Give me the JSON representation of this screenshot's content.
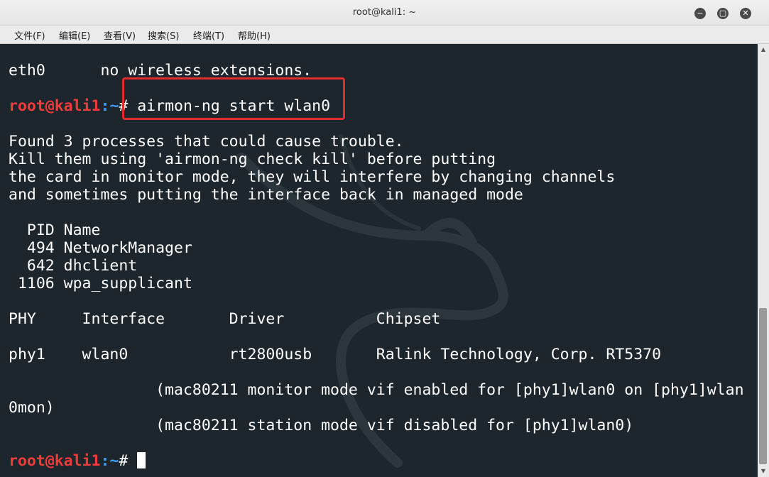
{
  "window": {
    "title": "root@kali1: ~",
    "controls": {
      "minimize": "−",
      "maximize": "▢",
      "close": "✕"
    }
  },
  "menu": [
    "文件(F)",
    "编辑(E)",
    "查看(V)",
    "搜索(S)",
    "终端(T)",
    "帮助(H)"
  ],
  "terminal": {
    "line_eth0": "eth0      no wireless extensions.",
    "prompt1": {
      "user": "root@kali1",
      "path": ":~",
      "command": "# airmon-ng start wlan0"
    },
    "warn1": "Found 3 processes that could cause trouble.",
    "warn2": "Kill them using 'airmon-ng check kill' before putting",
    "warn3": "the card in monitor mode, they will interfere by changing channels",
    "warn4": "and sometimes putting the interface back in managed mode",
    "proc_header": "  PID Name",
    "proc1": "  494 NetworkManager",
    "proc2": "  642 dhclient",
    "proc3": " 1106 wpa_supplicant",
    "iface_header": "PHY     Interface       Driver          Chipset",
    "iface_row": "phy1    wlan0           rt2800usb       Ralink Technology, Corp. RT5370",
    "mon1a": "                (mac80211 monitor mode vif enabled for [phy1]wlan0 on [phy1]wlan",
    "mon1b": "0mon)",
    "mon2": "                (mac80211 station mode vif disabled for [phy1]wlan0)",
    "prompt2": {
      "user": "root@kali1",
      "path": ":~",
      "command": "# "
    }
  },
  "colors": {
    "background": "#1c262c",
    "text": "#ffffff",
    "prompt_user": "#ef3b3b",
    "prompt_path": "#3f9bf3",
    "highlight": "#e42a2a"
  },
  "icons": {
    "background": "kali-dragon-watermark",
    "scroll_up": "triangle-up-icon",
    "scroll_down": "triangle-down-icon"
  }
}
